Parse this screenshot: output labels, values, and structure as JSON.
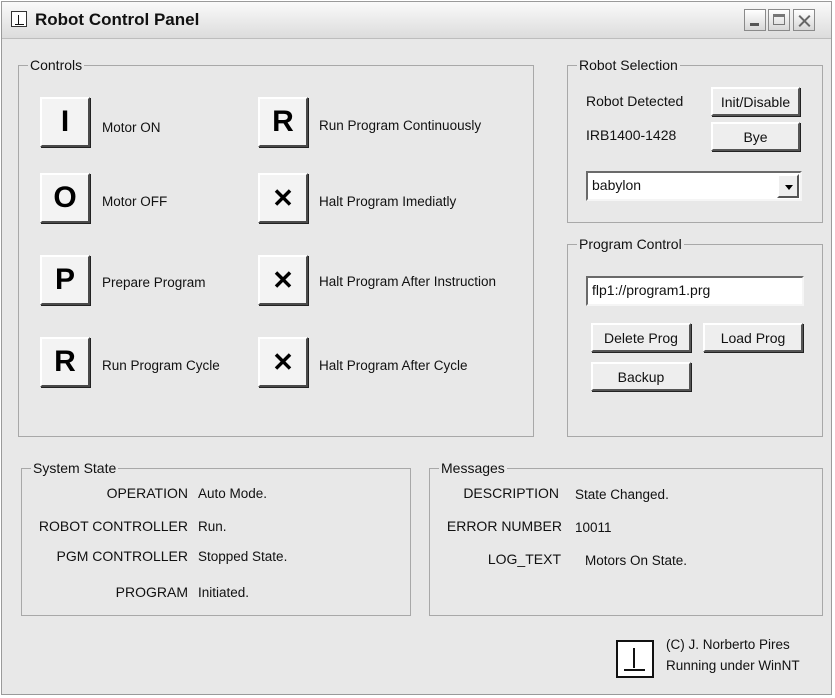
{
  "window": {
    "title": "Robot Control Panel"
  },
  "controls": {
    "group_label": "Controls",
    "buttons": [
      {
        "glyph": "I",
        "label": "Motor ON"
      },
      {
        "glyph": "O",
        "label": "Motor OFF"
      },
      {
        "glyph": "P",
        "label": "Prepare Program"
      },
      {
        "glyph": "R",
        "label": "Run Program Cycle"
      },
      {
        "glyph": "R",
        "label": "Run Program Continuously"
      },
      {
        "glyph": "✕",
        "label": "Halt Program Imediatly"
      },
      {
        "glyph": "✕",
        "label": "Halt Program After Instruction"
      },
      {
        "glyph": "✕",
        "label": "Halt Program After Cycle"
      }
    ]
  },
  "robot_selection": {
    "group_label": "Robot Selection",
    "detected_label": "Robot Detected",
    "robot_id": "IRB1400-1428",
    "init_button": "Init/Disable",
    "bye_button": "Bye",
    "host_value": "babylon"
  },
  "program_control": {
    "group_label": "Program Control",
    "program_path": "flp1://program1.prg",
    "delete_button": "Delete Prog",
    "load_button": "Load Prog",
    "backup_button": "Backup"
  },
  "system_state": {
    "group_label": "System State",
    "rows": [
      {
        "key": "OPERATION",
        "value": "Auto Mode."
      },
      {
        "key": "ROBOT CONTROLLER",
        "value": "Run."
      },
      {
        "key": "PGM CONTROLLER",
        "value": "Stopped State."
      },
      {
        "key": "PROGRAM",
        "value": "Initiated."
      }
    ]
  },
  "messages": {
    "group_label": "Messages",
    "rows": [
      {
        "key": "DESCRIPTION",
        "value": "State Changed."
      },
      {
        "key": "ERROR NUMBER",
        "value": "10011"
      },
      {
        "key": "LOG_TEXT",
        "value": "Motors On State."
      }
    ]
  },
  "footer": {
    "line1": "(C) J. Norberto Pires",
    "line2": "Running under WinNT"
  }
}
